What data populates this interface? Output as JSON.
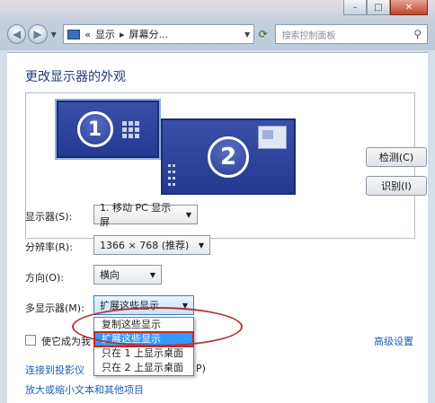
{
  "titlebar": {
    "min": "–",
    "max": "□",
    "close": "✕"
  },
  "nav": {
    "back": "◀",
    "forward": "▶",
    "breadcrumb_prefix": "«",
    "crumb1": "显示",
    "crumb_sep": "▸",
    "crumb2": "屏幕分...",
    "search_placeholder": "搜索控制面板"
  },
  "page": {
    "heading": "更改显示器的外观"
  },
  "monitors": {
    "m1": "1",
    "m2": "2"
  },
  "buttons": {
    "detect": "检测(C)",
    "identify": "识别(I)"
  },
  "settings": {
    "display_label": "显示器(S):",
    "display_value": "1. 移动 PC 显示屏",
    "resolution_label": "分辨率(R):",
    "resolution_value": "1366 × 768 (推荐)",
    "orientation_label": "方向(O):",
    "orientation_value": "横向",
    "multi_label": "多显示器(M):",
    "multi_value": "扩展这些显示"
  },
  "dropdown": {
    "options": [
      "复制这些显示",
      "扩展这些显示",
      "只在 1 上显示桌面",
      "只在 2 上显示桌面"
    ]
  },
  "checkbox": {
    "label": "使它成为我"
  },
  "links": {
    "advanced": "高级设置",
    "projector": "连接到投影仪",
    "projector_suffix": "P)",
    "text_size": "放大或缩小文本和其他项目"
  },
  "colors": {
    "accent": "#1e3b79",
    "selection": "#3399ff",
    "highlight_ring": "#b3343a",
    "link": "#1f5fb3"
  }
}
